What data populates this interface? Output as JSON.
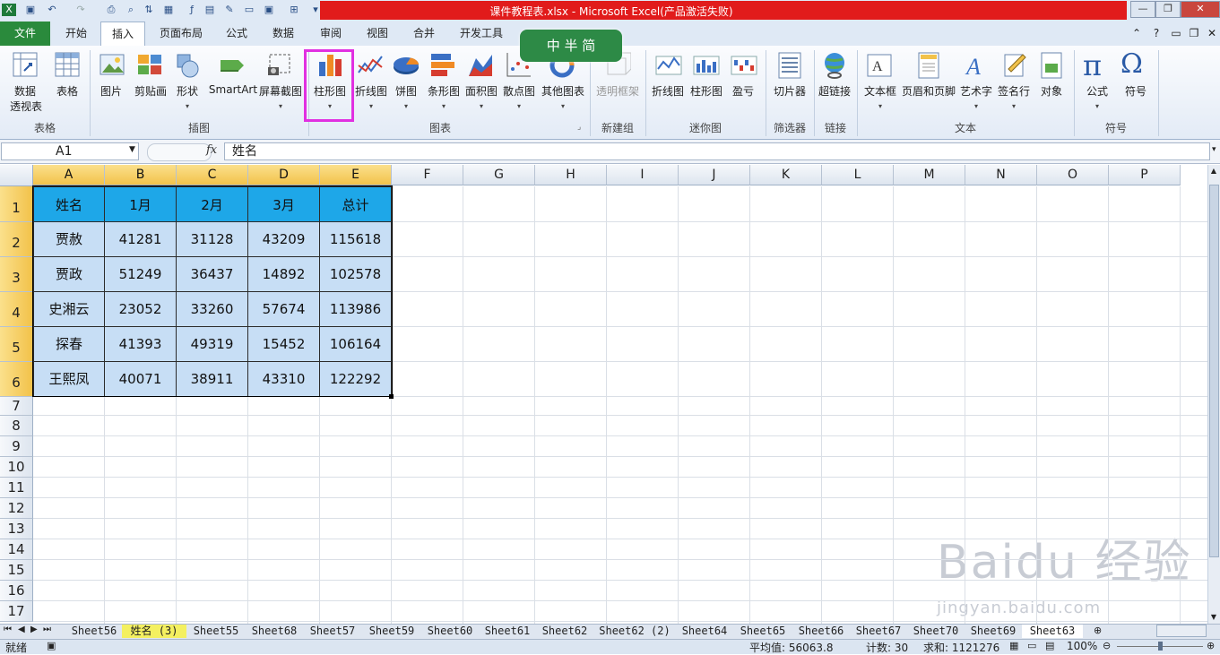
{
  "title": "课件教程表.xlsx - Microsoft Excel(产品激活失败)",
  "tabs": [
    "文件",
    "开始",
    "插入",
    "页面布局",
    "公式",
    "数据",
    "审阅",
    "视图",
    "合并",
    "开发工具"
  ],
  "ribbon": {
    "pivot_label_1": "数据",
    "pivot_label_2": "透视表",
    "table": "表格",
    "picture": "图片",
    "clipart": "剪贴画",
    "shapes": "形状",
    "smartart": "SmartArt",
    "screenshot": "屏幕截图",
    "column_chart": "柱形图",
    "line_chart": "折线图",
    "pie_chart": "饼图",
    "bar_chart": "条形图",
    "area_chart": "面积图",
    "scatter_chart": "散点图",
    "other_charts": "其他图表",
    "transparent_frame": "透明框架",
    "spark_line": "折线图",
    "spark_column": "柱形图",
    "spark_winloss": "盈亏",
    "slicer": "切片器",
    "hyperlink": "超链接",
    "textbox": "文本框",
    "header_footer": "页眉和页脚",
    "wordart": "艺术字",
    "signature": "签名行",
    "object": "对象",
    "equation": "公式",
    "symbol": "符号",
    "groups": {
      "tables": "表格",
      "illustrations": "插图",
      "charts": "图表",
      "new_group": "新建组",
      "sparklines": "迷你图",
      "filter": "筛选器",
      "links": "链接",
      "text": "文本",
      "symbols": "符号"
    }
  },
  "formula_bar": {
    "name_box": "A1",
    "fx": "fx",
    "content": "姓名"
  },
  "columns": [
    "A",
    "B",
    "C",
    "D",
    "E",
    "F",
    "G",
    "H",
    "I",
    "J",
    "K",
    "L",
    "M",
    "N",
    "O",
    "P"
  ],
  "rows": [
    "1",
    "2",
    "3",
    "4",
    "5",
    "6",
    "7",
    "8",
    "9",
    "10",
    "11",
    "12",
    "13",
    "14",
    "15",
    "16",
    "17"
  ],
  "table": {
    "header": [
      "姓名",
      "1月",
      "2月",
      "3月",
      "总计"
    ],
    "rows": [
      [
        "贾赦",
        "41281",
        "31128",
        "43209",
        "115618"
      ],
      [
        "贾政",
        "51249",
        "36437",
        "14892",
        "102578"
      ],
      [
        "史湘云",
        "23052",
        "33260",
        "57674",
        "113986"
      ],
      [
        "探春",
        "41393",
        "49319",
        "15452",
        "106164"
      ],
      [
        "王熙凤",
        "40071",
        "38911",
        "43310",
        "122292"
      ]
    ]
  },
  "sheets": [
    "Sheet56",
    "姓名 (3)",
    "Sheet55",
    "Sheet68",
    "Sheet57",
    "Sheet59",
    "Sheet60",
    "Sheet61",
    "Sheet62",
    "Sheet62 (2)",
    "Sheet64",
    "Sheet65",
    "Sheet66",
    "Sheet67",
    "Sheet70",
    "Sheet69",
    "Sheet63"
  ],
  "status": {
    "mode": "就绪",
    "average": "平均值: 56063.8",
    "count": "计数: 30",
    "sum": "求和: 1121276",
    "zoom": "100%"
  },
  "badge": "中 半 简",
  "watermark_1": "Baidu 经验",
  "watermark_2": "jingyan.baidu.com"
}
